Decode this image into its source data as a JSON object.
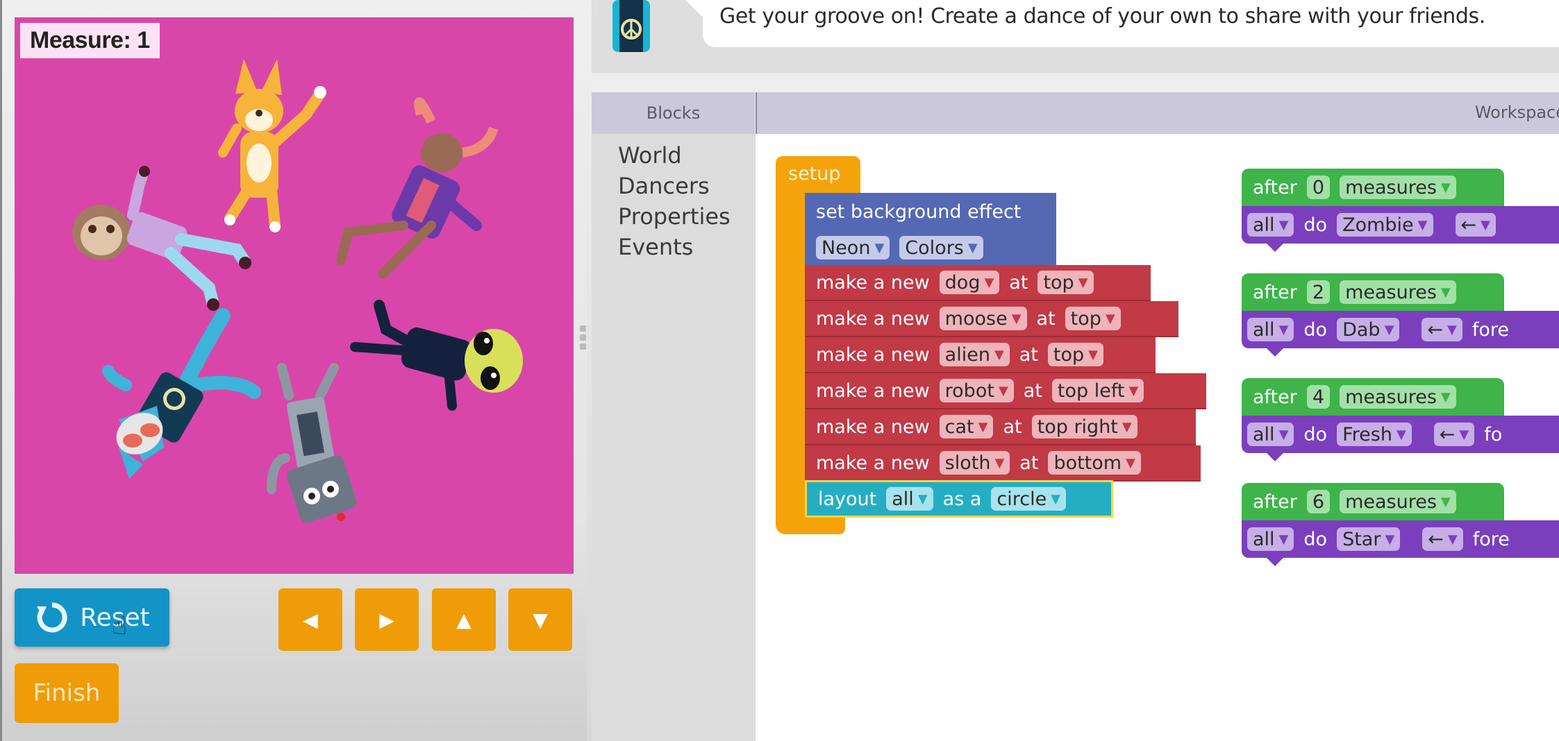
{
  "stage": {
    "measure_label": "Measure: 1",
    "background_color": "#d946a9",
    "dancers": [
      "dog",
      "moose",
      "alien",
      "robot",
      "cat",
      "sloth"
    ]
  },
  "controls": {
    "reset_label": "Reset",
    "finish_label": "Finish",
    "arrows": [
      {
        "name": "left",
        "glyph": "◀"
      },
      {
        "name": "right",
        "glyph": "▶"
      },
      {
        "name": "up",
        "glyph": "▲"
      },
      {
        "name": "down",
        "glyph": "▼"
      }
    ]
  },
  "instructions": {
    "text": "Get your groove on! Create a dance of your own to share with your friends."
  },
  "toolbox": {
    "header": "Blocks",
    "categories": [
      "World",
      "Dancers",
      "Properties",
      "Events"
    ]
  },
  "workspace": {
    "header": "Workspace",
    "setup": {
      "label": "setup",
      "background": {
        "label": "set background effect",
        "effect": "Neon",
        "palette": "Colors"
      },
      "make_blocks": [
        {
          "prefix": "make a new",
          "dancer": "dog",
          "at": "at",
          "position": "top"
        },
        {
          "prefix": "make a new",
          "dancer": "moose",
          "at": "at",
          "position": "top"
        },
        {
          "prefix": "make a new",
          "dancer": "alien",
          "at": "at",
          "position": "top"
        },
        {
          "prefix": "make a new",
          "dancer": "robot",
          "at": "at",
          "position": "top left"
        },
        {
          "prefix": "make a new",
          "dancer": "cat",
          "at": "at",
          "position": "top right"
        },
        {
          "prefix": "make a new",
          "dancer": "sloth",
          "at": "at",
          "position": "bottom"
        }
      ],
      "layout": {
        "label": "layout",
        "group": "all",
        "as_label": "as a",
        "shape": "circle"
      }
    },
    "events": [
      {
        "after": "after",
        "count": "0",
        "unit": "measures",
        "who": "all",
        "do": "do",
        "move": "Zombie",
        "dir": "←",
        "tail": ""
      },
      {
        "after": "after",
        "count": "2",
        "unit": "measures",
        "who": "all",
        "do": "do",
        "move": "Dab",
        "dir": "←",
        "tail": "fore"
      },
      {
        "after": "after",
        "count": "4",
        "unit": "measures",
        "who": "all",
        "do": "do",
        "move": "Fresh",
        "dir": "←",
        "tail": "fo"
      },
      {
        "after": "after",
        "count": "6",
        "unit": "measures",
        "who": "all",
        "do": "do",
        "move": "Star",
        "dir": "←",
        "tail": "fore"
      }
    ]
  }
}
